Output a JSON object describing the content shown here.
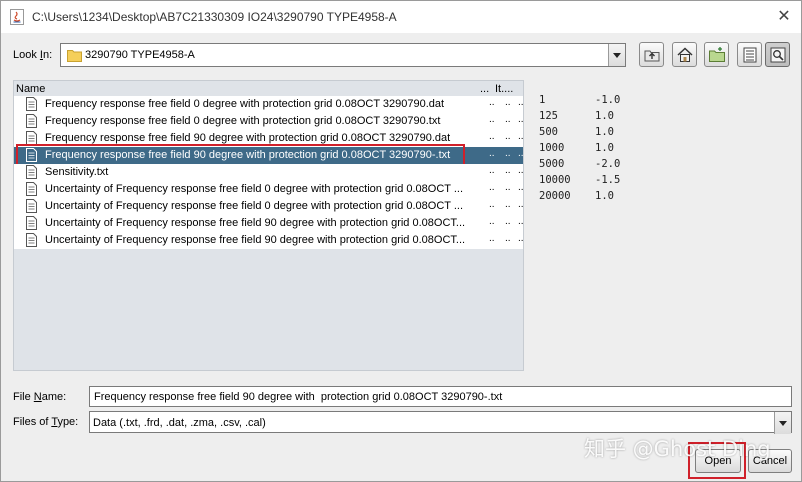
{
  "window": {
    "title": "C:\\Users\\1234\\Desktop\\AB7C21330309 IO24\\3290790 TYPE4958-A",
    "close_symbol": "✕"
  },
  "look_in": {
    "label_prefix": "Look ",
    "label_mnemonic": "I",
    "label_suffix": "n:",
    "value": "3290790 TYPE4958-A"
  },
  "toolbar": {
    "buttons": [
      "up-one-level-icon",
      "home-icon",
      "new-folder-icon",
      "list-view-icon",
      "details-view-icon"
    ]
  },
  "file_list": {
    "headers": {
      "name": "Name",
      "col1": "...",
      "col2": "It...."
    },
    "rows": [
      {
        "name": "Frequency response free field 0 degree with  protection grid 0.08OCT 3290790.dat",
        "c1": "..",
        "c2": "..",
        "c3": "..",
        "selected": false
      },
      {
        "name": "Frequency response free field 0 degree with  protection grid 0.08OCT 3290790.txt",
        "c1": "..",
        "c2": "..",
        "c3": "..",
        "selected": false
      },
      {
        "name": "Frequency response free field 90 degree with  protection grid 0.08OCT 3290790.dat",
        "c1": "..",
        "c2": "..",
        "c3": "..",
        "selected": false
      },
      {
        "name": "Frequency response free field 90 degree with  protection grid 0.08OCT 3290790-.txt",
        "c1": "..",
        "c2": "..",
        "c3": "..",
        "selected": true
      },
      {
        "name": "Sensitivity.txt",
        "c1": "..",
        "c2": "..",
        "c3": "..",
        "selected": false
      },
      {
        "name": "Uncertainty of Frequency response free field 0 degree with  protection grid 0.08OCT ...",
        "c1": "..",
        "c2": "..",
        "c3": "..",
        "selected": false
      },
      {
        "name": "Uncertainty of Frequency response free field 0 degree with  protection grid 0.08OCT ...",
        "c1": "..",
        "c2": "..",
        "c3": "..",
        "selected": false
      },
      {
        "name": "Uncertainty of Frequency response free field 90 degree with  protection grid 0.08OCT...",
        "c1": "..",
        "c2": "..",
        "c3": "..",
        "selected": false
      },
      {
        "name": "Uncertainty of Frequency response free field 90 degree with  protection grid 0.08OCT...",
        "c1": "..",
        "c2": "..",
        "c3": "..",
        "selected": false
      }
    ]
  },
  "preview": {
    "rows": [
      {
        "freq": "1",
        "value": "-1.0"
      },
      {
        "freq": "125",
        "value": "1.0"
      },
      {
        "freq": "500",
        "value": "1.0"
      },
      {
        "freq": "1000",
        "value": "1.0"
      },
      {
        "freq": "5000",
        "value": "-2.0"
      },
      {
        "freq": "10000",
        "value": "-1.5"
      },
      {
        "freq": "20000",
        "value": "1.0"
      }
    ]
  },
  "file_name": {
    "label_prefix": "File ",
    "label_mnemonic": "N",
    "label_suffix": "ame:",
    "value": "Frequency response free field 90 degree with  protection grid 0.08OCT 3290790-.txt"
  },
  "file_type": {
    "label_prefix": "Files of ",
    "label_mnemonic": "T",
    "label_suffix": "ype:",
    "value": "Data (.txt, .frd, .dat, .zma, .csv, .cal)"
  },
  "buttons": {
    "open": "Open",
    "cancel": "Cancel"
  },
  "watermark": "知乎 @Ghost Ding",
  "colors": {
    "selection": "#3e6a88",
    "highlight_outline": "#d0202a",
    "list_background": "#dfe3e8"
  }
}
